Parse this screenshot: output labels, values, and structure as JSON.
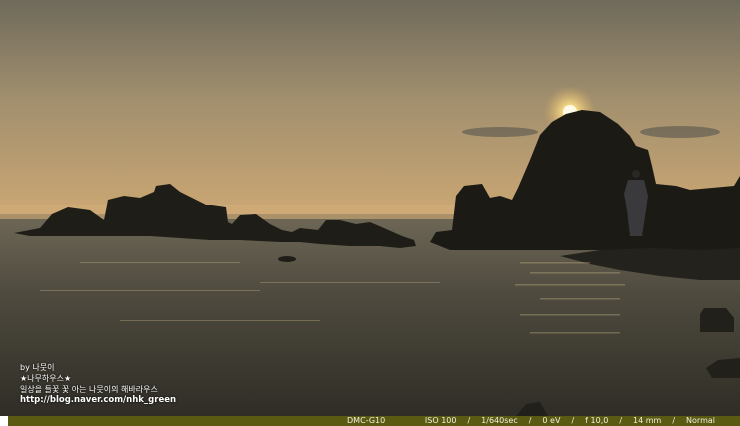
{
  "watermark": {
    "line1": "by 나뭇이",
    "line2": "★나무하우스★",
    "line3": "일상을 들꽃 꽃 아는 나뭇이의 해바라우스",
    "url": "http://blog.naver.com/nhk_green"
  },
  "exif": {
    "camera": "DMC-G10",
    "iso": "ISO 100",
    "shutter": "1/640sec",
    "ev": "0 eV",
    "aperture": "f 10,0",
    "focal": "14 mm",
    "mode": "Normal",
    "separator": "/"
  },
  "colors": {
    "sky_top": "#7b7463",
    "sky_horizon": "#c8a56f",
    "sun": "#fff3b0",
    "rock": "#1c1b16",
    "water": "#4e4b3f",
    "exif_bar": "#5a5a12"
  }
}
